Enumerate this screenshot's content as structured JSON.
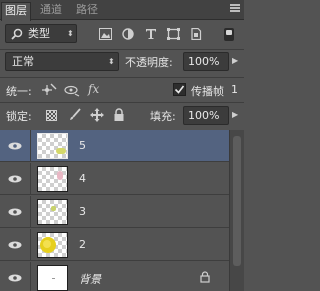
{
  "tabs": [
    {
      "label": "图层",
      "active": true
    },
    {
      "label": "通道",
      "active": false
    },
    {
      "label": "路径",
      "active": false
    }
  ],
  "filter": {
    "label": "类型"
  },
  "blend_mode": {
    "value": "正常"
  },
  "opacity": {
    "label": "不透明度:",
    "value": "100%"
  },
  "unify": {
    "label": "统一:",
    "propagate_label": "传播帧",
    "propagate_value": "1"
  },
  "lock": {
    "label": "锁定:"
  },
  "fill": {
    "label": "填充:",
    "value": "100%"
  },
  "layers": [
    {
      "name": "5",
      "selected": true
    },
    {
      "name": "4",
      "selected": false
    },
    {
      "name": "3",
      "selected": false
    },
    {
      "name": "2",
      "selected": false
    },
    {
      "name": "背景",
      "selected": false,
      "locked": true
    }
  ],
  "colors": {
    "panel": "#535353",
    "selected": "#536380",
    "input": "#3c3c3c"
  }
}
